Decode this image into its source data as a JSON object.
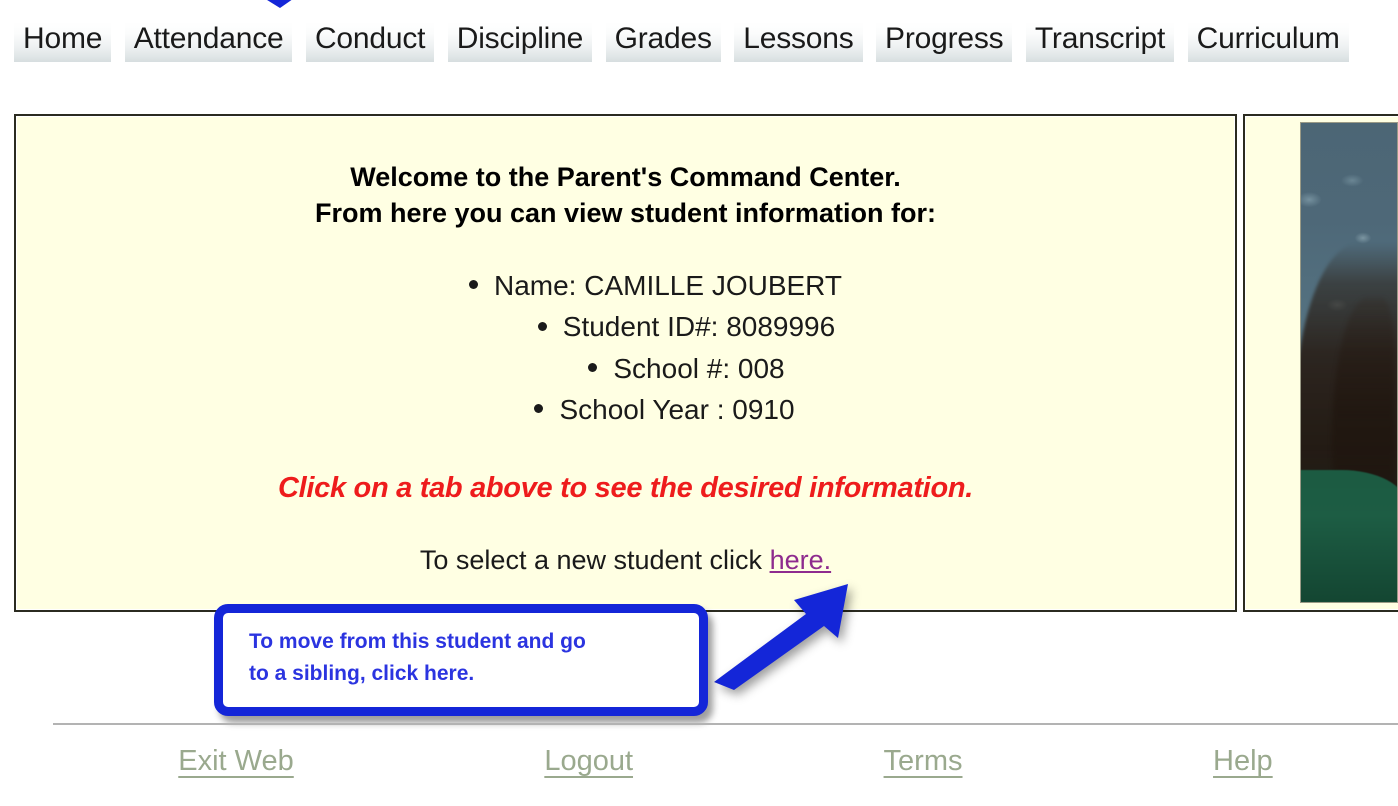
{
  "tabs": [
    {
      "label": "Home"
    },
    {
      "label": "Attendance"
    },
    {
      "label": "Conduct"
    },
    {
      "label": "Discipline"
    },
    {
      "label": "Grades"
    },
    {
      "label": "Lessons"
    },
    {
      "label": "Progress"
    },
    {
      "label": "Transcript"
    },
    {
      "label": "Curriculum"
    }
  ],
  "main": {
    "welcome_line1": "Welcome to the Parent's Command Center.",
    "welcome_line2": "From here you can view student information for:",
    "info": [
      {
        "label": "Name: CAMILLE JOUBERT"
      },
      {
        "label": "Student ID#: 8089996"
      },
      {
        "label": "School #: 008"
      },
      {
        "label": "School Year : 0910"
      }
    ],
    "instruction": "Click on a tab above to see the desired information.",
    "select_new_prefix": "To select a new student click ",
    "select_new_link": "here."
  },
  "annotation": {
    "text": "To move from this student and go\nto a sibling, click here.",
    "color": "#1426d8"
  },
  "footer": {
    "links": [
      {
        "label": "Exit Web"
      },
      {
        "label": "Logout"
      },
      {
        "label": "Terms"
      },
      {
        "label": "Help"
      }
    ]
  },
  "colors": {
    "panel_background": "#ffffe3",
    "panel_border": "#2b2b20",
    "instruction_red": "#ee1c1c",
    "link_purple": "#8e2b8e",
    "footer_link": "#9aa98e",
    "annotation_blue": "#1426d8"
  }
}
